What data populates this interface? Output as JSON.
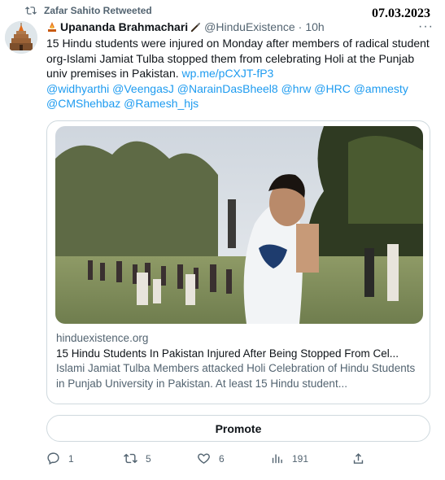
{
  "date_stamp": "07.03.2023",
  "retweet": {
    "label": "Zafar Sahito Retweeted"
  },
  "tweet": {
    "author_name": "Upananda Brahmachari",
    "author_handle": "@HinduExistence",
    "separator": "·",
    "time": "10h",
    "more": "···",
    "text_main": "15 Hindu students were injured on Monday after members of radical student org-Islami Jamiat Tulba stopped them from celebrating Holi at the Punjab univ premises in Pakistan.",
    "link": "wp.me/pCXJT-fP3",
    "mentions": [
      "@widhyarthi",
      "@VeengasJ",
      "@NarainDasBheel8",
      "@hrw",
      "@HRC",
      "@amnesty",
      "@CMShehbaz",
      "@Ramesh_hjs"
    ]
  },
  "card": {
    "domain": "hinduexistence.org",
    "title": "15 Hindu Students In Pakistan Injured After Being Stopped From Cel...",
    "description": "Islami Jamiat Tulba Members attacked Holi Celebration of Hindu Students in Punjab University in Pakistan. At least 15 Hindu student..."
  },
  "promote_label": "Promote",
  "actions": {
    "reply_count": "1",
    "retweet_count": "5",
    "like_count": "6",
    "views_count": "191"
  },
  "colors": {
    "link": "#1d9bf0",
    "secondary": "#536471",
    "border": "#cfd9de"
  }
}
